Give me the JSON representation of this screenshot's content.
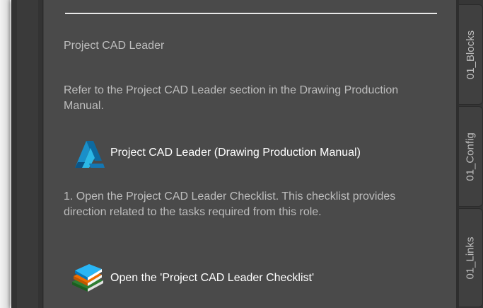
{
  "palette": {
    "content_bg": "#4a4a4a",
    "text_muted": "#bdbdbd",
    "text_link": "#ffffff",
    "tab_bg": "#404040"
  },
  "content": {
    "heading": "Project CAD Leader",
    "intro": "Refer to the Project CAD Leader section in the Drawing Production Manual.",
    "link1": {
      "label": "Project CAD Leader (Drawing Production Manual)",
      "icon": "autocad-logo-icon"
    },
    "step1": "1. Open the Project CAD Leader Checklist. This checklist provides direction related to the tasks required from this role.",
    "link2": {
      "label": "Open the 'Project CAD Leader Checklist'",
      "icon": "books-icon"
    }
  },
  "tabs": [
    {
      "label": "01_Blocks"
    },
    {
      "label": "01_Config"
    },
    {
      "label": "01_Links"
    }
  ]
}
